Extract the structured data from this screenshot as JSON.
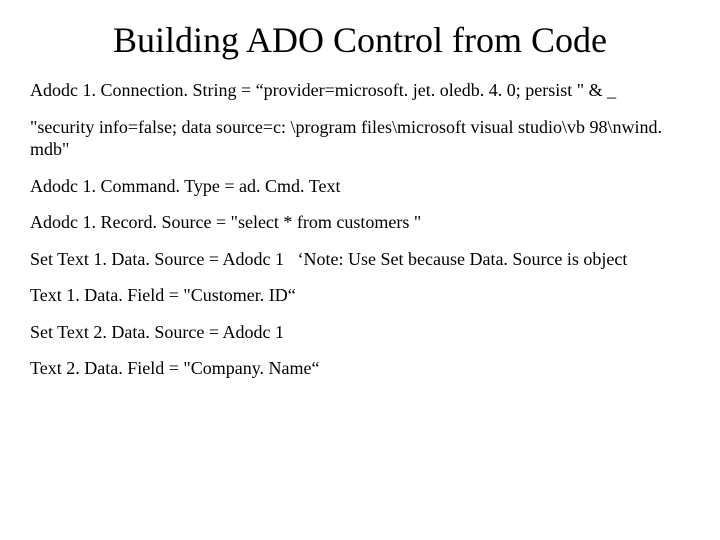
{
  "title": "Building ADO Control from Code",
  "lines": [
    "Adodc 1. Connection. String = “provider=microsoft. jet. oledb. 4. 0; persist \" & _",
    "\"security info=false; data source=c: \\program files\\microsoft visual studio\\vb 98\\nwind. mdb\"",
    "Adodc 1. Command. Type = ad. Cmd. Text",
    "Adodc 1. Record. Source = \"select * from customers \"",
    "Set Text 1. Data. Source = Adodc 1   ‘Note: Use Set because Data. Source is object",
    "Text 1. Data. Field = \"Customer. ID“",
    "Set Text 2. Data. Source = Adodc 1",
    "Text 2. Data. Field = \"Company. Name“"
  ]
}
